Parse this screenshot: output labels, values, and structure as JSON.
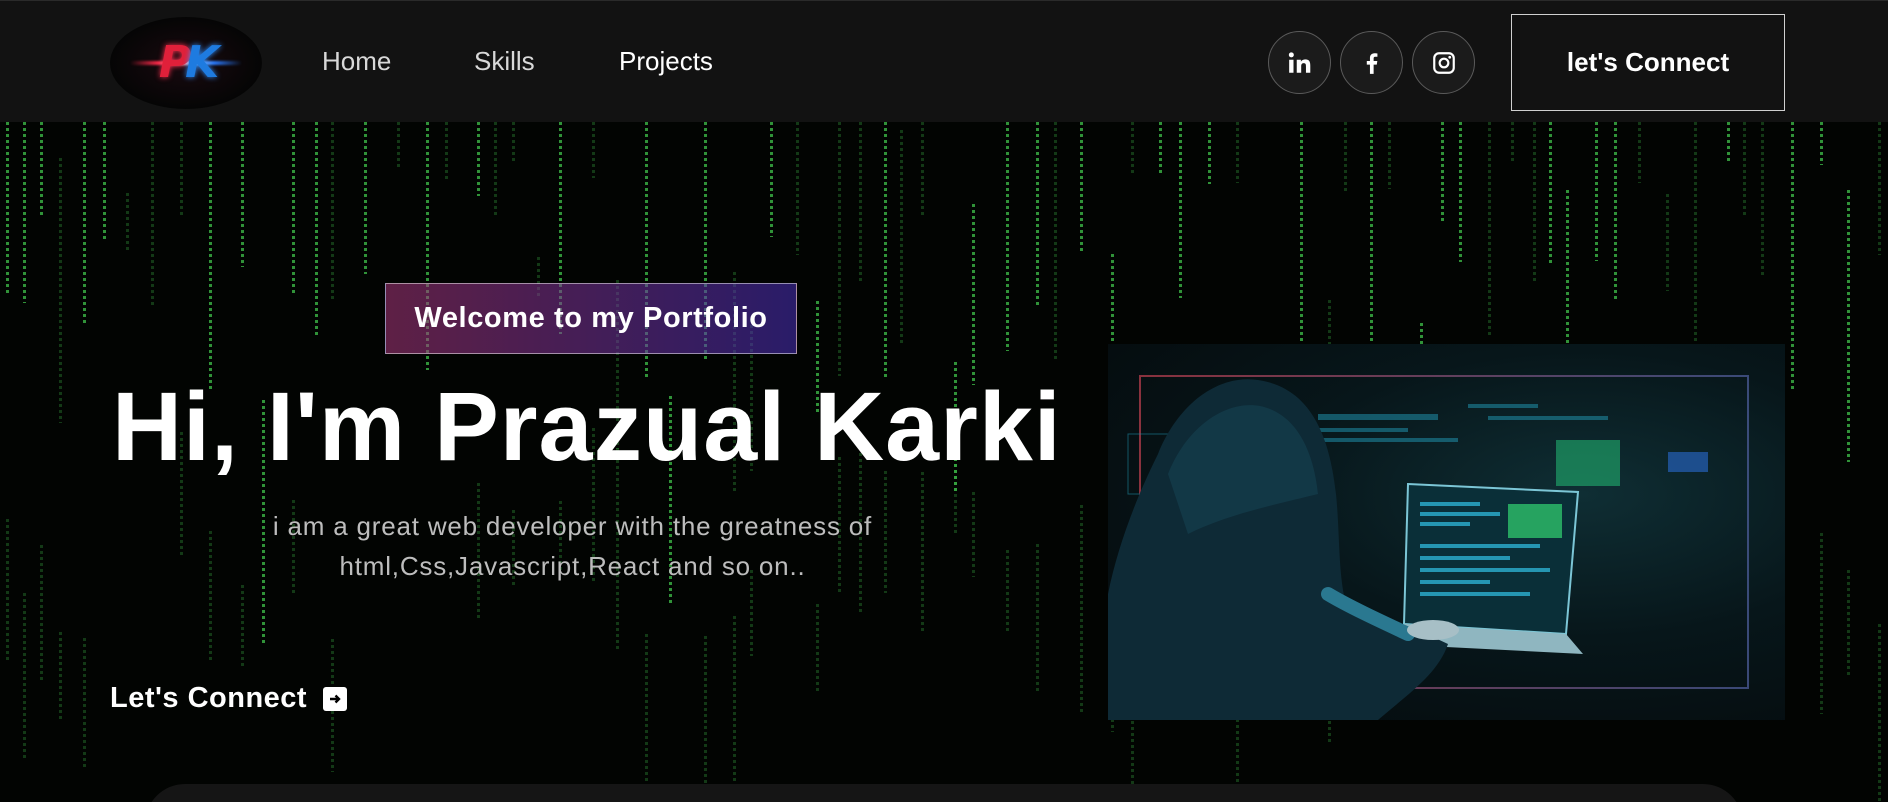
{
  "nav": {
    "logo_text": "PK",
    "links": [
      {
        "label": "Home",
        "active": false
      },
      {
        "label": "Skills",
        "active": false
      },
      {
        "label": "Projects",
        "active": true
      }
    ],
    "socials": [
      "linkedin-icon",
      "facebook-icon",
      "instagram-icon"
    ],
    "connect_label": "let's Connect"
  },
  "hero": {
    "badge": "Welcome to my Portfolio",
    "title": "Hi, I'm Prazual Karki",
    "description": "i am a great web developer with the greatness of html,Css,Javascript,React and so on..",
    "cta_label": "Let's Connect",
    "cta_icon": "arrow-right-box-icon",
    "image_icon": "hooded-hacker-illustration"
  },
  "colors": {
    "nav_bg": "#121212",
    "rain": "#3fc24a",
    "badge_start": "#aa367c",
    "badge_end": "#4a2fbd",
    "accent_screen": "#2aa8c8"
  }
}
